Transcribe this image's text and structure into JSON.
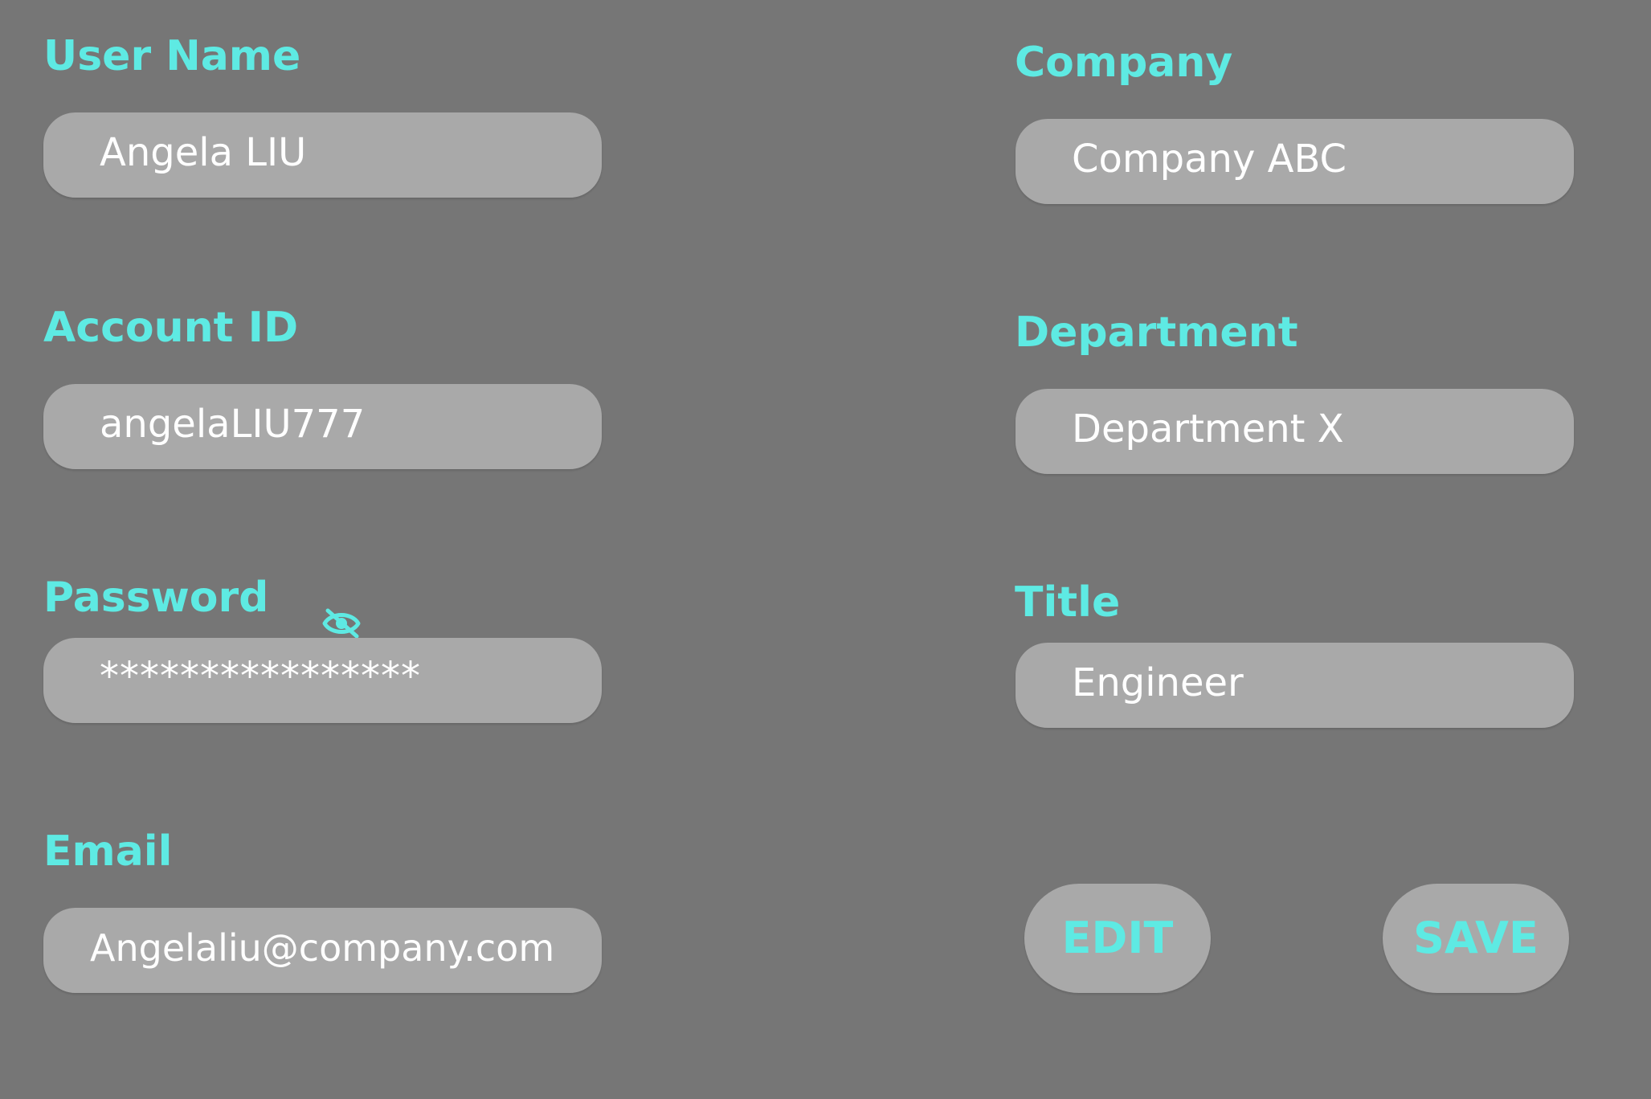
{
  "left_column": {
    "user_name": {
      "label": "User Name",
      "value": "Angela LIU"
    },
    "account_id": {
      "label": "Account ID",
      "value": "angelaLIU777"
    },
    "password": {
      "label": "Password",
      "value": "****************",
      "visibility_icon": "eye-off-icon"
    },
    "email": {
      "label": "Email",
      "value": "Angelaliu@company.com"
    }
  },
  "right_column": {
    "company": {
      "label": "Company",
      "value": "Company ABC"
    },
    "department": {
      "label": "Department",
      "value": "Department X"
    },
    "title": {
      "label": "Title",
      "value": "Engineer"
    }
  },
  "actions": {
    "edit_label": "EDIT",
    "save_label": "SAVE"
  },
  "colors": {
    "background": "#767676",
    "field": "#a9a9a9",
    "accent": "#5eeae3",
    "text": "#ffffff"
  }
}
